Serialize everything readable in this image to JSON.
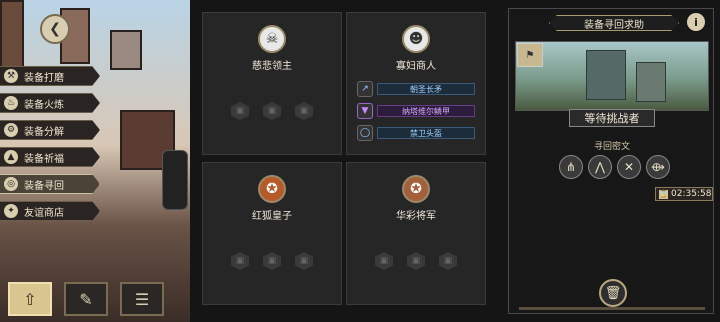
{
  "nav": [
    {
      "label": "装备打磨",
      "icon": "hammer-icon",
      "glyph": "⚒"
    },
    {
      "label": "装备火炼",
      "icon": "flame-icon",
      "glyph": "♨"
    },
    {
      "label": "装备分解",
      "icon": "gear-icon",
      "glyph": "⚙"
    },
    {
      "label": "装备祈福",
      "icon": "pray-icon",
      "glyph": "▲"
    },
    {
      "label": "装备寻回",
      "icon": "retrieve-icon",
      "glyph": "◎"
    },
    {
      "label": "友谊商店",
      "icon": "fox-shop-icon",
      "glyph": "✦"
    }
  ],
  "bottom": {
    "home": "⇧",
    "feather": "✎",
    "menu": "☰"
  },
  "cards": [
    {
      "name": "慈悲领主",
      "portrait": "☠",
      "type": "empty",
      "slots": [
        "▣",
        "▣",
        "▣"
      ]
    },
    {
      "name": "寡妇商人",
      "portrait": "☻",
      "type": "items",
      "items": [
        {
          "label": "朝圣长矛",
          "icon": "spear-icon",
          "glyph": "↗",
          "rarity": "blue"
        },
        {
          "label": "纳塔维尔鳞甲",
          "icon": "armor-icon",
          "glyph": "▼",
          "rarity": "purple"
        },
        {
          "label": "禁卫头盔",
          "icon": "helmet-icon",
          "glyph": "◯",
          "rarity": "blue"
        }
      ]
    },
    {
      "name": "红狐皇子",
      "portrait": "✪",
      "type": "empty",
      "slots": [
        "▣",
        "▣",
        "▣"
      ]
    },
    {
      "name": "华彩将军",
      "portrait": "✪",
      "type": "empty",
      "slots": [
        "▣",
        "▣",
        "▣"
      ]
    }
  ],
  "panel": {
    "title": "装备寻回求助",
    "info": "i",
    "waiting": "等待挑战者",
    "code_label": "寻回密文",
    "codes": [
      "⋔",
      "⋀",
      "✕",
      "⟴"
    ],
    "timer": "02:35:58",
    "trash": "🗑"
  }
}
